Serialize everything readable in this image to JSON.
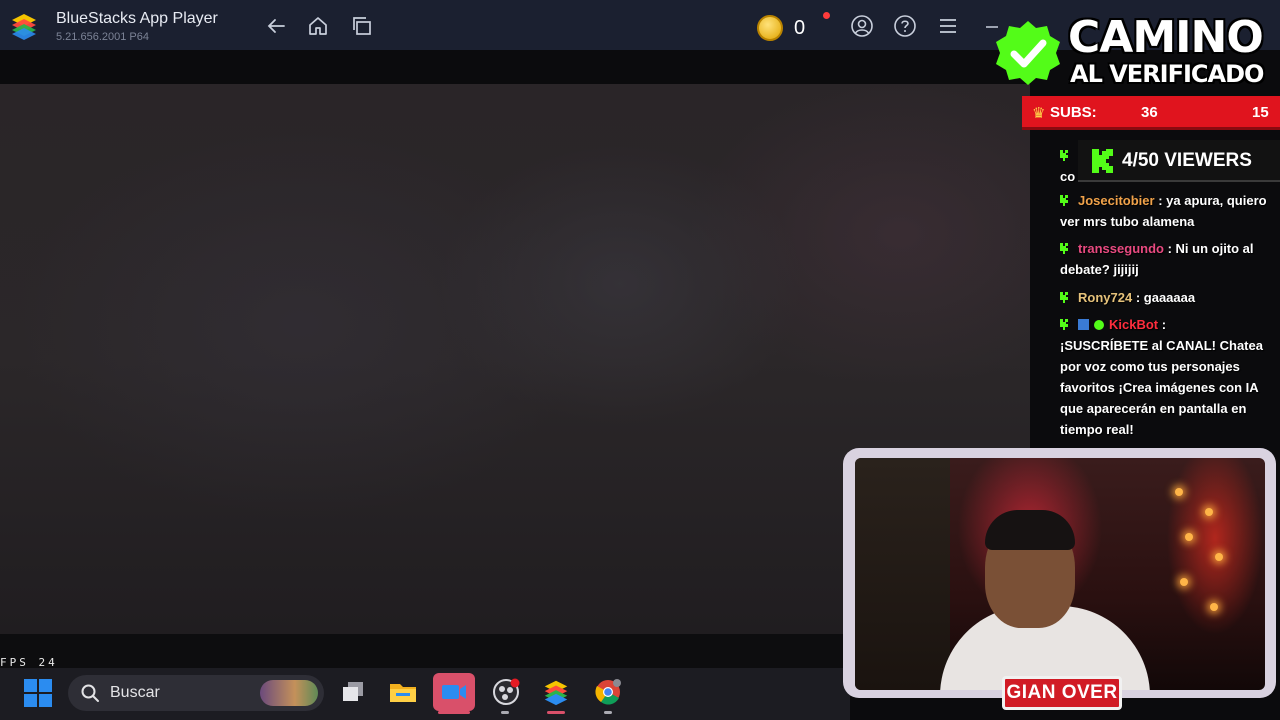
{
  "window": {
    "app_title": "BlueStacks App Player",
    "version": "5.21.656.2001 P64",
    "coins": "0"
  },
  "stage": {
    "fps_label": "FPS",
    "fps_value": "24"
  },
  "taskbar": {
    "search_placeholder": "Buscar",
    "apps": [
      "start",
      "task-view",
      "file-explorer",
      "video-app",
      "obs",
      "bluestacks",
      "chrome"
    ]
  },
  "overlay": {
    "goal_title_line1": "CAMINO",
    "goal_title_line2": "AL VERIFICADO",
    "subs_label": "SUBS:",
    "subs_current": "36",
    "subs_goal": "15",
    "viewers": "4/50 VIEWERS",
    "streamer_name": "GIAN OVER"
  },
  "chat": {
    "messages": [
      {
        "user": "Josecitobier",
        "text": ": ya apura, quiero ver mrs tubo alamena"
      },
      {
        "user": "transsegundo",
        "text": ": Ni un ojito al debate? jijijij"
      },
      {
        "user": "Rony724",
        "text": ": gaaaaaa"
      },
      {
        "user": "KickBot",
        "text": ":"
      }
    ],
    "bot_message": "¡SUSCRÍBETE al CANAL! Chatea por voz como tus personajes favoritos ¡Crea imágenes con IA que aparecerán en pantalla en tiempo real!",
    "partial_line": "co"
  },
  "colors": {
    "titlebar": "#1b2030",
    "kick_green": "#53fc18",
    "subs_red": "#e0141e",
    "cam_frame": "#d9d2e0"
  }
}
